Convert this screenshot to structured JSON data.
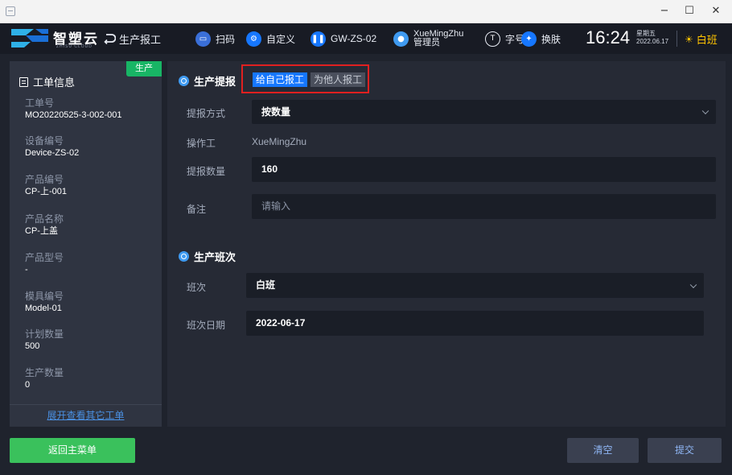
{
  "window": {
    "minimize": "−",
    "maximize": "☐",
    "close": "✕"
  },
  "header": {
    "logo_cn": "智塑云",
    "logo_en": "ZHISU CLOUD",
    "page_title": "生产报工",
    "scan_label": "扫码",
    "custom_label": "自定义",
    "device_label": "GW-ZS-02",
    "user_name": "XueMingZhu",
    "user_role": "管理员",
    "font_label": "字号",
    "skin_label": "换肤",
    "time": "16:24",
    "weekday": "星期五",
    "date": "2022.06.17",
    "shift": "白班",
    "colors": {
      "scan_icon": "#3a6fd8",
      "custom_icon": "#1677ff",
      "device_icon": "#1677ff",
      "user_icon": "#3f9af0",
      "shift_color": "#ffc400"
    }
  },
  "left_panel": {
    "status_tag": "生产",
    "title": "工单信息",
    "fields": [
      {
        "label": "工单号",
        "value": "MO20220525-3-002-001"
      },
      {
        "label": "设备编号",
        "value": "Device-ZS-02"
      },
      {
        "label": "产品编号",
        "value": "CP-上-001"
      },
      {
        "label": "产品名称",
        "value": "CP-上盖"
      },
      {
        "label": "产品型号",
        "value": "-"
      },
      {
        "label": "模具编号",
        "value": "Model-01"
      },
      {
        "label": "计划数量",
        "value": "500"
      },
      {
        "label": "生产数量",
        "value": "0"
      }
    ],
    "expand_link": "展开查看其它工单"
  },
  "report_section": {
    "title": "生产提报",
    "tab_self": "给自己报工",
    "tab_others": "为他人报工",
    "method_label": "提报方式",
    "method_value": "按数量",
    "operator_label": "操作工",
    "operator_value": "XueMingZhu",
    "quantity_label": "提报数量",
    "quantity_value": "160",
    "remark_label": "备注",
    "remark_placeholder": "请输入"
  },
  "shift_section": {
    "title": "生产班次",
    "shift_label": "班次",
    "shift_value": "白班",
    "date_label": "班次日期",
    "date_value": "2022-06-17"
  },
  "footer": {
    "home_button": "返回主菜单",
    "clear_button": "清空",
    "submit_button": "提交"
  }
}
